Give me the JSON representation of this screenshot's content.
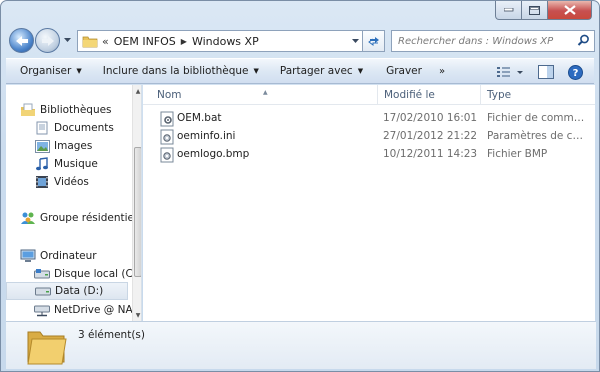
{
  "address": {
    "segments": [
      "OEM INFOS",
      "Windows XP"
    ],
    "overflow_marker": "«"
  },
  "search": {
    "placeholder": "Rechercher dans : Windows XP"
  },
  "commands": {
    "organize": "Organiser",
    "include": "Inclure dans la bibliothèque",
    "share": "Partager avec",
    "burn": "Graver",
    "more": "»"
  },
  "nav": {
    "libraries": "Bibliothèques",
    "documents": "Documents",
    "images": "Images",
    "music": "Musique",
    "videos": "Vidéos",
    "homegroup": "Groupe résidentiel",
    "computer": "Ordinateur",
    "local_disk": "Disque local (C:)",
    "data_drive": "Data (D:)",
    "netdrive": "NetDrive @ NAS"
  },
  "columns": {
    "name": "Nom",
    "modified": "Modifié le",
    "type": "Type"
  },
  "files": [
    {
      "name": "OEM.bat",
      "date": "17/02/2010 16:01",
      "type": "Fichier de comma...",
      "icon": "batch-file-icon"
    },
    {
      "name": "oeminfo.ini",
      "date": "27/01/2012 21:22",
      "type": "Paramètres de co...",
      "icon": "ini-file-icon"
    },
    {
      "name": "oemlogo.bmp",
      "date": "10/12/2011 14:23",
      "type": "Fichier BMP",
      "icon": "bmp-file-icon"
    }
  ],
  "details": {
    "count": "3 élément(s)"
  },
  "colors": {
    "chrome": "#cbdcee",
    "close_red": "#c75050",
    "header_text": "#4c607a",
    "selection": "#dde6f0"
  }
}
